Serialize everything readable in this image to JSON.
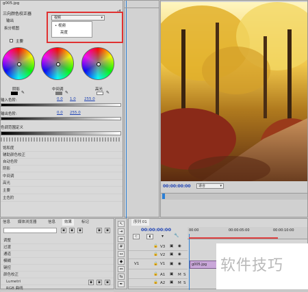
{
  "effects_panel": {
    "file_name": "g005.jpg",
    "effect_title": "三向颜色校正器",
    "output_label": "输出",
    "output_select": "视频",
    "split_view_label": "拆分视图",
    "dropdown_options": [
      "视频",
      "亮度"
    ],
    "master_label": "主要",
    "wheel_labels": [
      "阴影",
      "中间调",
      "高光"
    ],
    "input_levels_label": "输入色阶:",
    "input_levels_values": [
      "0.0",
      "1.0",
      "255.0"
    ],
    "output_levels_label": "输出色阶:",
    "output_levels_values": [
      "0.0",
      "255.0"
    ],
    "tonal_range_label": "色调范围定义",
    "rows": [
      "饱和度",
      "辅助颜色校正",
      "自动色阶",
      "阴影",
      "中间调",
      "高光",
      "主要",
      "主色阶"
    ]
  },
  "program_monitor": {
    "timecode": "00:00:00:00",
    "fit_select": "适合"
  },
  "effects_browser": {
    "tabs": [
      "信息",
      "媒体浏览器",
      "信息",
      "效果",
      "标记"
    ],
    "items": [
      "调整",
      "过渡",
      "通道",
      "模糊",
      "键控",
      "颜色校正",
      "Lumetri",
      "RGB 曲线"
    ]
  },
  "timeline": {
    "tab": "序列 01",
    "timecode": "00:00:00:00",
    "ruler_marks": [
      "00:00",
      "00:00:05:00",
      "00:00:10:00"
    ],
    "video_tracks": [
      "V3",
      "V2",
      "V1"
    ],
    "audio_tracks": [
      "A1",
      "A2",
      "A3"
    ],
    "clip_name": "g005.jpg",
    "source_label": "V1"
  },
  "watermark": "软件技巧",
  "colors": {
    "highlight_box": "#e03030",
    "accent_blue": "#1a3fb3",
    "playhead": "#2a7fd6"
  }
}
